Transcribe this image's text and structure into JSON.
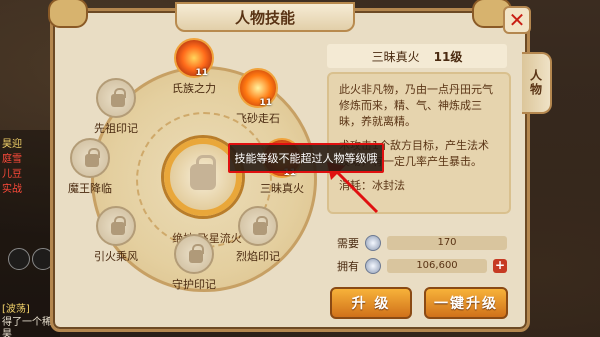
{
  "window": {
    "title": "人物技能",
    "side_tab": "人物"
  },
  "chat": {
    "lines": [
      {
        "text": "昊迎",
        "color": "yellow"
      },
      {
        "text": "庭雪",
        "color": "red"
      },
      {
        "text": "儿豆",
        "color": "red"
      },
      {
        "text": "实战",
        "color": "red"
      },
      {
        "text": "[波荡]",
        "color": "yellow"
      },
      {
        "text": "得了一个稀",
        "color": "white"
      },
      {
        "text": "昊",
        "color": "white"
      }
    ]
  },
  "skills": [
    {
      "name": "氏族之力",
      "level": "11",
      "locked": false,
      "style": "fire"
    },
    {
      "name": "飞砂走石",
      "level": "11",
      "locked": false,
      "style": "fire2"
    },
    {
      "name": "三昧真火",
      "level": "11",
      "locked": false,
      "style": "fire"
    },
    {
      "name": "烈焰印记",
      "level": "",
      "locked": true
    },
    {
      "name": "守护印记",
      "level": "",
      "locked": true
    },
    {
      "name": "引火乘风",
      "level": "",
      "locked": true
    },
    {
      "name": "魔王降临",
      "level": "",
      "locked": true
    },
    {
      "name": "先祖印记",
      "level": "",
      "locked": true
    }
  ],
  "center": {
    "label": "绝技  飞星流火"
  },
  "selected_skill": {
    "name": "三昧真火",
    "level": "11级",
    "description_1": "此火非凡物，乃由一点丹田元气修炼而来，精、气、神炼成三昧，养就离精。",
    "description_2": "术攻击1个敌方目标，产生法术波动，有一定几率产生暴击。",
    "description_3": "消耗：冰封法"
  },
  "resources": {
    "need_label": "需要",
    "need_value": "170",
    "own_label": "拥有",
    "own_value": "106,600"
  },
  "buttons": {
    "upgrade": "升 级",
    "upgrade_all": "一键升级"
  },
  "tooltip": {
    "text": "技能等级不能超过人物等级哦"
  },
  "colors": {
    "accent": "#f0a33c",
    "tooltip_border": "#e01010",
    "close_x": "#c81e14"
  }
}
